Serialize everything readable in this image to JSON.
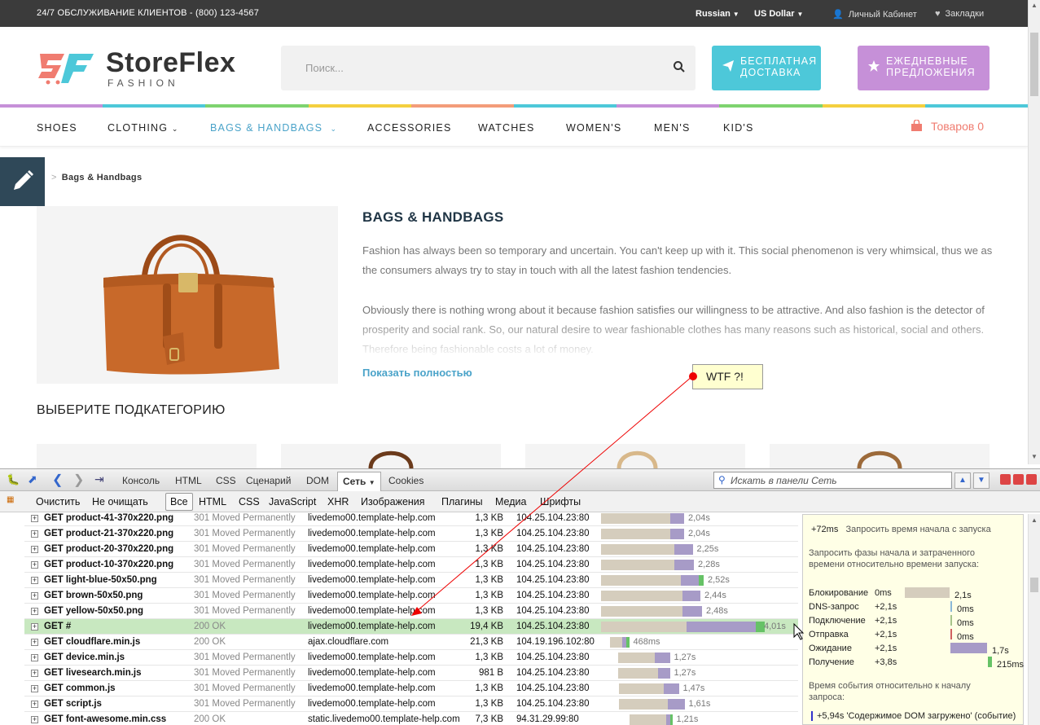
{
  "topbar": {
    "phone": "24/7 ОБСЛУЖИВАНИЕ КЛИЕНТОВ - (800) 123-4567",
    "language": "Russian",
    "currency": "US Dollar",
    "account": "Личный Кабинет",
    "wishlist": "Закладки"
  },
  "header": {
    "brand": "StoreFlex",
    "brand_sub": "FASHION",
    "search_placeholder": "Поиск...",
    "shipping_btn": "БЕСПЛАТНАЯ ДОСТАВКА",
    "deals_btn": "ЕЖЕДНЕВНЫЕ ПРЕДЛОЖЕНИЯ"
  },
  "stripe_colors": [
    "#c690d8",
    "#4dc8d9",
    "#7ed36f",
    "#f4d03f",
    "#f39c7a",
    "#4dc8d9",
    "#c690d8",
    "#7ed36f",
    "#f4d03f",
    "#4dc8d9"
  ],
  "nav": {
    "items": [
      "SHOES",
      "CLOTHING",
      "BAGS & HANDBAGS",
      "ACCESSORIES",
      "WATCHES",
      "WOMEN'S",
      "MEN'S",
      "KID'S"
    ],
    "cart": "Товаров 0"
  },
  "breadcrumb": {
    "sep": ">",
    "current": "Bags & Handbags"
  },
  "category": {
    "title": "BAGS & HANDBAGS",
    "p1": "Fashion has always been so temporary and uncertain. You can't keep up with it. This social phenomenon is very whimsical, thus we as the consumers always try to stay in touch with all the latest fashion tendencies.",
    "p2": "Obviously there is nothing wrong about it because fashion satisfies our willingness to be attractive. And also fashion is the detector of prosperity and social rank. So, our natural desire to wear fashionable clothes has many reasons such as historical, social and others. Therefore being fashionable costs a lot of money.",
    "show_more": "Показать полностью",
    "subcategory_heading": "ВЫБЕРИТЕ ПОДКАТЕГОРИЮ"
  },
  "annotation": {
    "text": "WTF ?!"
  },
  "firebug": {
    "tabs": [
      "Консоль",
      "HTML",
      "CSS",
      "Сценарий",
      "DOM",
      "Сеть",
      "Cookies"
    ],
    "search_placeholder": "Искать в панели Сеть",
    "filters": [
      "Очистить",
      "Не очищать",
      "Все",
      "HTML",
      "CSS",
      "JavaScript",
      "XHR",
      "Изображения",
      "Плагины",
      "Медиа",
      "Шрифты"
    ],
    "requests": [
      {
        "url": "GET product-41-370x220.png",
        "status": "301 Moved Permanently",
        "domain": "livedemo00.template-help.com",
        "size": "1,3 KB",
        "ip": "104.25.104.23:80",
        "time": "2,04s",
        "w0": 0,
        "w1": 1.7,
        "w2": 0.34,
        "w3": 0
      },
      {
        "url": "GET product-21-370x220.png",
        "status": "301 Moved Permanently",
        "domain": "livedemo00.template-help.com",
        "size": "1,3 KB",
        "ip": "104.25.104.23:80",
        "time": "2,04s",
        "w0": 0,
        "w1": 1.7,
        "w2": 0.34,
        "w3": 0
      },
      {
        "url": "GET product-20-370x220.png",
        "status": "301 Moved Permanently",
        "domain": "livedemo00.template-help.com",
        "size": "1,3 KB",
        "ip": "104.25.104.23:80",
        "time": "2,25s",
        "w0": 0,
        "w1": 1.8,
        "w2": 0.45,
        "w3": 0
      },
      {
        "url": "GET product-10-370x220.png",
        "status": "301 Moved Permanently",
        "domain": "livedemo00.template-help.com",
        "size": "1,3 KB",
        "ip": "104.25.104.23:80",
        "time": "2,28s",
        "w0": 0,
        "w1": 1.8,
        "w2": 0.48,
        "w3": 0
      },
      {
        "url": "GET light-blue-50x50.png",
        "status": "301 Moved Permanently",
        "domain": "livedemo00.template-help.com",
        "size": "1,3 KB",
        "ip": "104.25.104.23:80",
        "time": "2,52s",
        "w0": 0,
        "w1": 1.95,
        "w2": 0.45,
        "w3": 0.12
      },
      {
        "url": "GET brown-50x50.png",
        "status": "301 Moved Permanently",
        "domain": "livedemo00.template-help.com",
        "size": "1,3 KB",
        "ip": "104.25.104.23:80",
        "time": "2,44s",
        "w0": 0,
        "w1": 2.0,
        "w2": 0.44,
        "w3": 0
      },
      {
        "url": "GET yellow-50x50.png",
        "status": "301 Moved Permanently",
        "domain": "livedemo00.template-help.com",
        "size": "1,3 KB",
        "ip": "104.25.104.23:80",
        "time": "2,48s",
        "w0": 0,
        "w1": 2.0,
        "w2": 0.48,
        "w3": 0
      },
      {
        "url": "GET #",
        "status": "200 OK",
        "domain": "livedemo00.template-help.com",
        "size": "19,4 KB",
        "ip": "104.25.104.23:80",
        "time": "4,01s",
        "w0": 0,
        "w1": 2.1,
        "w2": 1.7,
        "w3": 0.21
      },
      {
        "url": "GET cloudflare.min.js",
        "status": "200 OK",
        "domain": "ajax.cloudflare.com",
        "size": "21,3 KB",
        "ip": "104.19.196.102:80",
        "time": "468ms",
        "w0": 0.12,
        "w1": 0.3,
        "w2": 0.1,
        "w3": 0.07
      },
      {
        "url": "GET device.min.js",
        "status": "301 Moved Permanently",
        "domain": "livedemo00.template-help.com",
        "size": "1,3 KB",
        "ip": "104.25.104.23:80",
        "time": "1,27s",
        "w0": 0.22,
        "w1": 0.9,
        "w2": 0.37,
        "w3": 0
      },
      {
        "url": "GET livesearch.min.js",
        "status": "301 Moved Permanently",
        "domain": "livedemo00.template-help.com",
        "size": "981 B",
        "ip": "104.25.104.23:80",
        "time": "1,27s",
        "w0": 0.22,
        "w1": 0.98,
        "w2": 0.29,
        "w3": 0
      },
      {
        "url": "GET common.js",
        "status": "301 Moved Permanently",
        "domain": "livedemo00.template-help.com",
        "size": "1,3 KB",
        "ip": "104.25.104.23:80",
        "time": "1,47s",
        "w0": 0.24,
        "w1": 1.1,
        "w2": 0.37,
        "w3": 0
      },
      {
        "url": "GET script.js",
        "status": "301 Moved Permanently",
        "domain": "livedemo00.template-help.com",
        "size": "1,3 KB",
        "ip": "104.25.104.23:80",
        "time": "1,61s",
        "w0": 0.24,
        "w1": 1.2,
        "w2": 0.41,
        "w3": 0
      },
      {
        "url": "GET font-awesome.min.css",
        "status": "200 OK",
        "domain": "static.livedemo00.template-help.com",
        "size": "7,3 KB",
        "ip": "94.31.29.99:80",
        "time": "1,21s",
        "w0": 0.3,
        "w1": 0.9,
        "w2": 0.1,
        "w3": 0.05
      }
    ],
    "tooltip": {
      "start_offset": "+72ms",
      "start_label": "Запросить время начала с запуска",
      "phases_heading": "Запросить фазы начала и затраченного времени относительно времени запуска:",
      "phases": [
        {
          "name": "Блокирование",
          "start": "0ms",
          "dur": "2,1s",
          "color": "#d5cdbd",
          "frac0": 0,
          "frac": 0.55
        },
        {
          "name": "DNS-запрос",
          "start": "+2,1s",
          "dur": "0ms",
          "color": "#8ab8d8",
          "frac0": 0.56,
          "frac": 0.01
        },
        {
          "name": "Подключение",
          "start": "+2,1s",
          "dur": "0ms",
          "color": "#a7c48a",
          "frac0": 0.56,
          "frac": 0.01
        },
        {
          "name": "Отправка",
          "start": "+2,1s",
          "dur": "0ms",
          "color": "#d06060",
          "frac0": 0.56,
          "frac": 0.01
        },
        {
          "name": "Ожидание",
          "start": "+2,1s",
          "dur": "1,7s",
          "color": "#a79bc7",
          "frac0": 0.56,
          "frac": 0.45
        },
        {
          "name": "Получение",
          "start": "+3,8s",
          "dur": "215ms",
          "color": "#66c266",
          "frac0": 1.02,
          "frac": 0.05
        }
      ],
      "events_heading": "Время события относительно к началу запроса:",
      "event": "+5,94s 'Содержимое DOM загружено' (событие)"
    }
  }
}
